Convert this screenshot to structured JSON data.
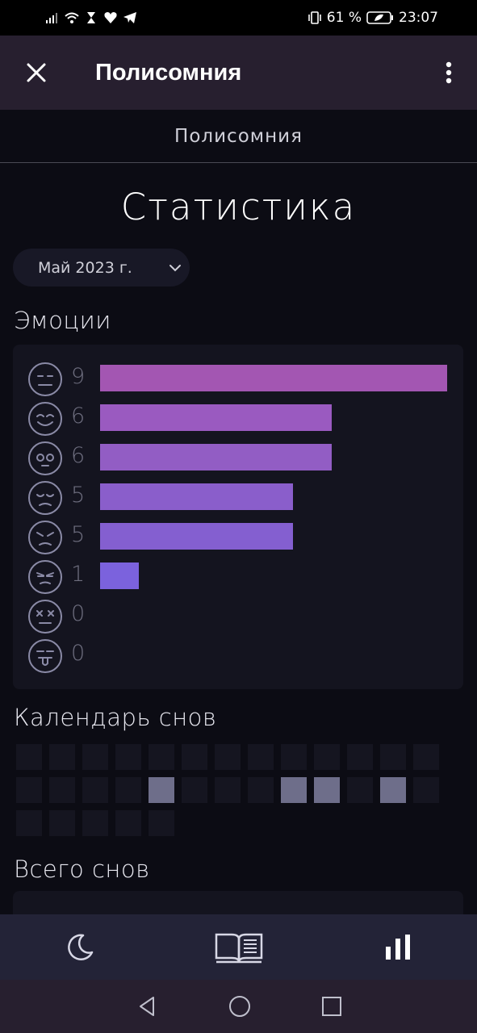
{
  "status": {
    "battery": "61 %",
    "time": "23:07"
  },
  "app_bar": {
    "title": "Полисомния",
    "close_icon": "close-icon",
    "menu_icon": "more-vert-icon"
  },
  "sub_header": "Полисомния",
  "page_title": "Статистика",
  "month_select": {
    "value": "Май 2023 г."
  },
  "emotions": {
    "title": "Эмоции",
    "max": 9,
    "items": [
      {
        "face": "neutral-face-icon",
        "count": "9",
        "value": 9,
        "color": "#a356b2"
      },
      {
        "face": "happy-face-icon",
        "count": "6",
        "value": 6,
        "color": "#9a5ac0"
      },
      {
        "face": "surprised-face-icon",
        "count": "6",
        "value": 6,
        "color": "#925dc4"
      },
      {
        "face": "sad-face-icon",
        "count": "5",
        "value": 5,
        "color": "#8a5ecb"
      },
      {
        "face": "angry-face-icon",
        "count": "5",
        "value": 5,
        "color": "#845fd0"
      },
      {
        "face": "annoyed-face-icon",
        "count": "1",
        "value": 1,
        "color": "#7b62dd"
      },
      {
        "face": "dead-face-icon",
        "count": "0",
        "value": 0,
        "color": "#7560e0"
      },
      {
        "face": "tongue-face-icon",
        "count": "0",
        "value": 0,
        "color": "#7060e0"
      }
    ]
  },
  "calendar": {
    "title": "Календарь снов",
    "days": 31,
    "active_days": [
      18,
      22,
      23,
      25
    ]
  },
  "total": {
    "title": "Всего снов"
  },
  "bottom_nav": [
    {
      "icon": "moon-icon",
      "active": false
    },
    {
      "icon": "book-icon",
      "active": false
    },
    {
      "icon": "bar-chart-icon",
      "active": true
    }
  ],
  "colors": {
    "accent": "#a356b2",
    "app_bar": "#271f2f",
    "background": "#0c0c14",
    "nav": "#232337"
  }
}
